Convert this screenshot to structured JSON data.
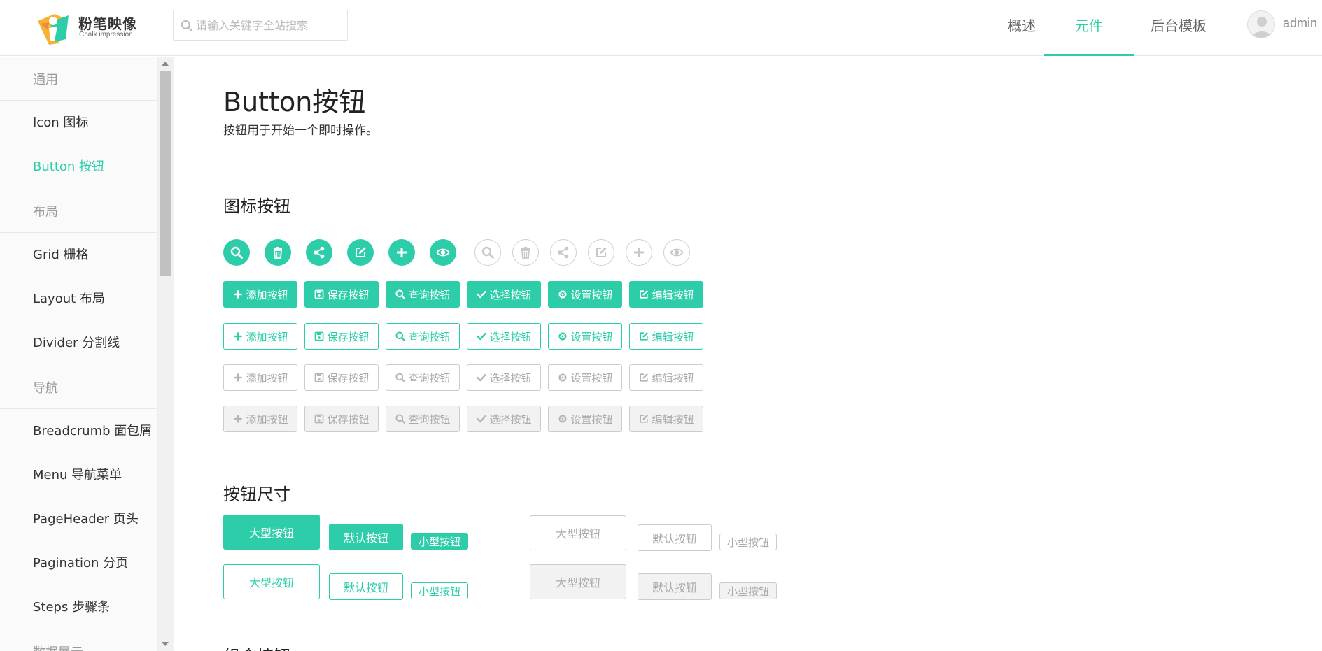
{
  "header": {
    "logo_cn": "粉笔映像",
    "logo_en": "Chalk impression",
    "search_placeholder": "请输入关键字全站搜索",
    "nav": [
      {
        "label": "概述",
        "active": false
      },
      {
        "label": "元件",
        "active": true
      },
      {
        "label": "后台模板",
        "active": false
      }
    ],
    "username": "admin"
  },
  "sidebar": {
    "items": [
      {
        "label": "通用",
        "type": "group"
      },
      {
        "label": "Icon 图标",
        "type": "item"
      },
      {
        "label": "Button 按钮",
        "type": "item",
        "active": true
      },
      {
        "label": "布局",
        "type": "group"
      },
      {
        "label": "Grid 栅格",
        "type": "item"
      },
      {
        "label": "Layout 布局",
        "type": "item"
      },
      {
        "label": "Divider 分割线",
        "type": "item"
      },
      {
        "label": "导航",
        "type": "group"
      },
      {
        "label": "Breadcrumb 面包屑",
        "type": "item"
      },
      {
        "label": "Menu 导航菜单",
        "type": "item"
      },
      {
        "label": "PageHeader 页头",
        "type": "item"
      },
      {
        "label": "Pagination 分页",
        "type": "item"
      },
      {
        "label": "Steps 步骤条",
        "type": "item"
      },
      {
        "label": "数据展示",
        "type": "group"
      }
    ]
  },
  "main": {
    "title": "Button按钮",
    "description": "按钮用于开始一个即时操作。",
    "sections": {
      "icon_buttons": "图标按钮",
      "sizes": "按钮尺寸",
      "group": "组合按钮"
    },
    "icons": [
      "search-icon",
      "trash-icon",
      "share-icon",
      "edit-icon",
      "plus-icon",
      "eye-icon"
    ],
    "action_buttons": [
      {
        "label": "添加按钮",
        "icon": "plus-icon"
      },
      {
        "label": "保存按钮",
        "icon": "save-icon"
      },
      {
        "label": "查询按钮",
        "icon": "search-icon"
      },
      {
        "label": "选择按钮",
        "icon": "check-icon"
      },
      {
        "label": "设置按钮",
        "icon": "gear-icon"
      },
      {
        "label": "编辑按钮",
        "icon": "edit-icon"
      }
    ],
    "size_labels": {
      "large": "大型按钮",
      "default": "默认按钮",
      "small": "小型按钮"
    }
  },
  "colors": {
    "accent": "#2ecdaa",
    "disabled_bg": "#f2f2f2",
    "disabled_text": "#aaaaaa",
    "border_gray": "#cccccc"
  }
}
